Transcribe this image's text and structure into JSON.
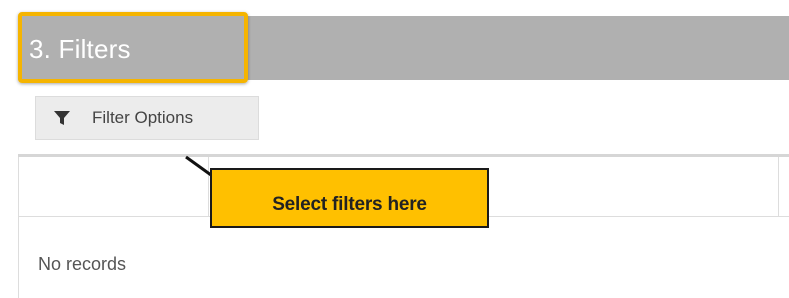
{
  "section": {
    "title": "3. Filters"
  },
  "toolbar": {
    "filter_button_label": "Filter Options",
    "filter_icon": "funnel-icon"
  },
  "grid": {
    "empty_message": "No records"
  },
  "annotation": {
    "callout_text": "Select filters here"
  },
  "colors": {
    "section_bar": "#b0b0b0",
    "highlight_border": "#f5b400",
    "callout_fill": "#ffc000"
  }
}
